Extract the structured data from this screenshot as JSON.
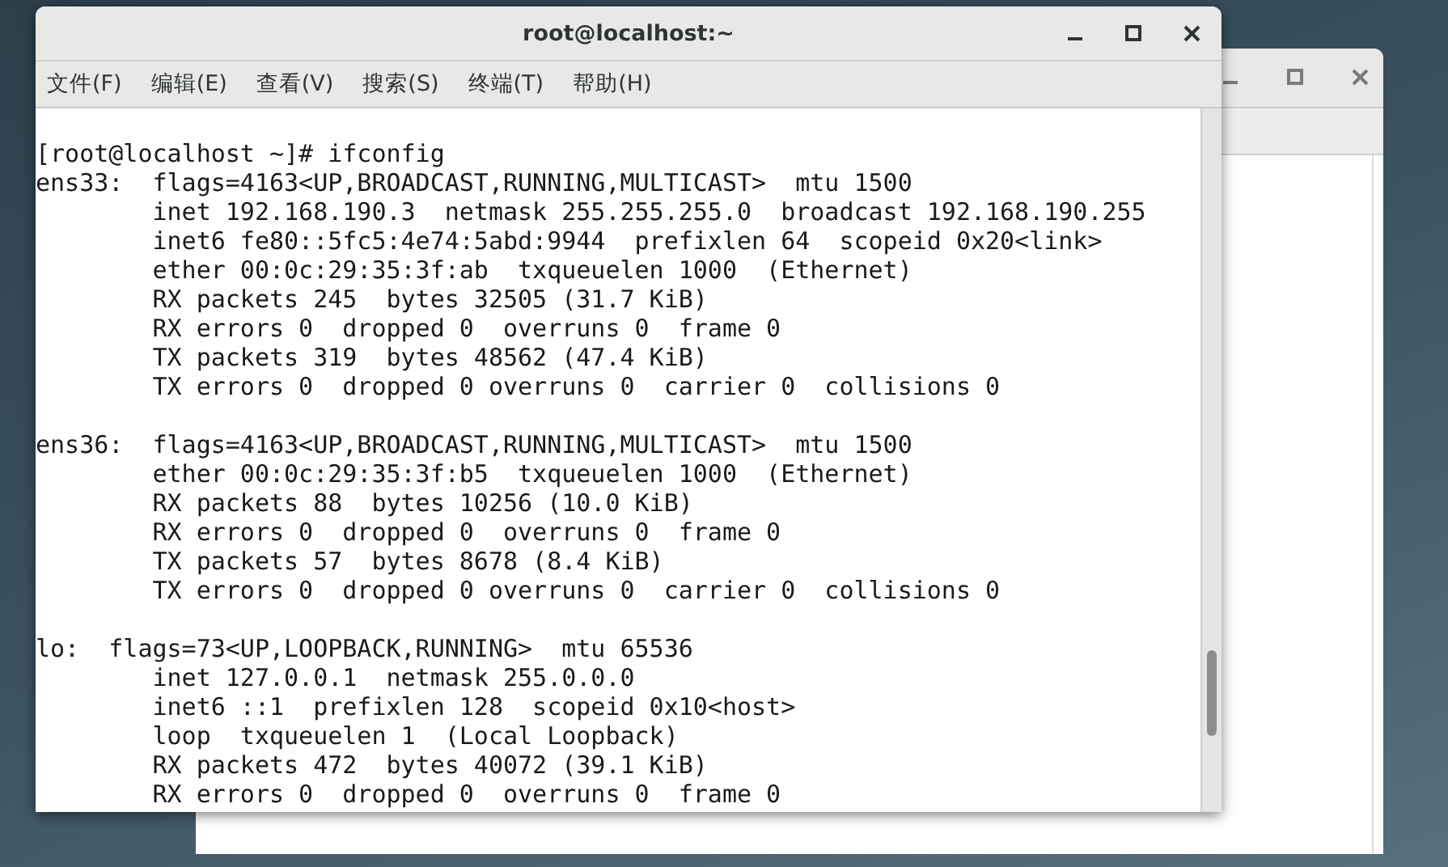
{
  "window": {
    "title": "root@localhost:~"
  },
  "menu": [
    "文件(F)",
    "编辑(E)",
    "查看(V)",
    "搜索(S)",
    "终端(T)",
    "帮助(H)"
  ],
  "terminal": {
    "prompt": "[root@localhost ~]# ifconfig",
    "output_blocks": [
      [
        "ens33:  flags=4163<UP,BROADCAST,RUNNING,MULTICAST>  mtu 1500",
        "        inet 192.168.190.3  netmask 255.255.255.0  broadcast 192.168.190.255",
        "        inet6 fe80::5fc5:4e74:5abd:9944  prefixlen 64  scopeid 0x20<link>",
        "        ether 00:0c:29:35:3f:ab  txqueuelen 1000  (Ethernet)",
        "        RX packets 245  bytes 32505 (31.7 KiB)",
        "        RX errors 0  dropped 0  overruns 0  frame 0",
        "        TX packets 319  bytes 48562 (47.4 KiB)",
        "        TX errors 0  dropped 0 overruns 0  carrier 0  collisions 0"
      ],
      [
        "ens36:  flags=4163<UP,BROADCAST,RUNNING,MULTICAST>  mtu 1500",
        "        ether 00:0c:29:35:3f:b5  txqueuelen 1000  (Ethernet)",
        "        RX packets 88  bytes 10256 (10.0 KiB)",
        "        RX errors 0  dropped 0  overruns 0  frame 0",
        "        TX packets 57  bytes 8678 (8.4 KiB)",
        "        TX errors 0  dropped 0 overruns 0  carrier 0  collisions 0"
      ],
      [
        "lo:  flags=73<UP,LOOPBACK,RUNNING>  mtu 65536",
        "        inet 127.0.0.1  netmask 255.0.0.0",
        "        inet6 ::1  prefixlen 128  scopeid 0x10<host>",
        "        loop  txqueuelen 1  (Local Loopback)",
        "        RX packets 472  bytes 40072 (39.1 KiB)",
        "        RX errors 0  dropped 0  overruns 0  frame 0"
      ]
    ]
  }
}
